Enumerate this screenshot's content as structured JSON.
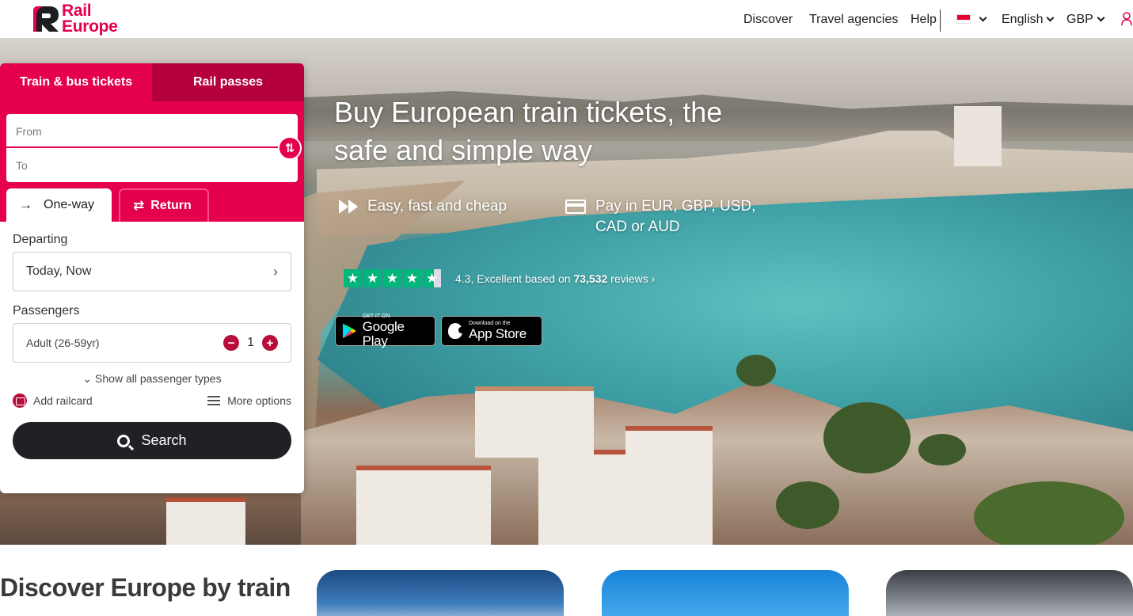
{
  "header": {
    "logo_line1": "Rail",
    "logo_line2": "Europe",
    "nav": [
      "Discover",
      "Travel agencies",
      "Help"
    ],
    "language": "English",
    "currency": "GBP"
  },
  "colors": {
    "brand": "#e4004f",
    "brand_dark": "#b5003f",
    "button_dark": "#1f2124",
    "trustpilot": "#00b67a"
  },
  "widget": {
    "tabs": [
      "Train & bus tickets",
      "Rail passes"
    ],
    "from_placeholder": "From",
    "to_placeholder": "To",
    "trip_types": [
      "One-way",
      "Return"
    ],
    "departing_label": "Departing",
    "departing_value": "Today, Now",
    "passengers_label": "Passengers",
    "passenger_type": "Adult (26-59yr)",
    "passenger_count": "1",
    "show_all": "Show all passenger types",
    "add_railcard": "Add railcard",
    "more_options": "More options",
    "search": "Search"
  },
  "hero": {
    "title": "Buy European train tickets, the safe and simple way",
    "feature1": "Easy, fast and cheap",
    "feature2": "Pay in EUR, GBP, USD, CAD or AUD",
    "rating_score": "4.3,",
    "rating_label": "Excellent based on",
    "rating_count": "73,532",
    "rating_suffix": "reviews",
    "google_small": "GET IT ON",
    "google_big": "Google Play",
    "apple_small": "Download on the",
    "apple_big": "App Store"
  },
  "discover": {
    "title": "Discover Europe by train"
  }
}
